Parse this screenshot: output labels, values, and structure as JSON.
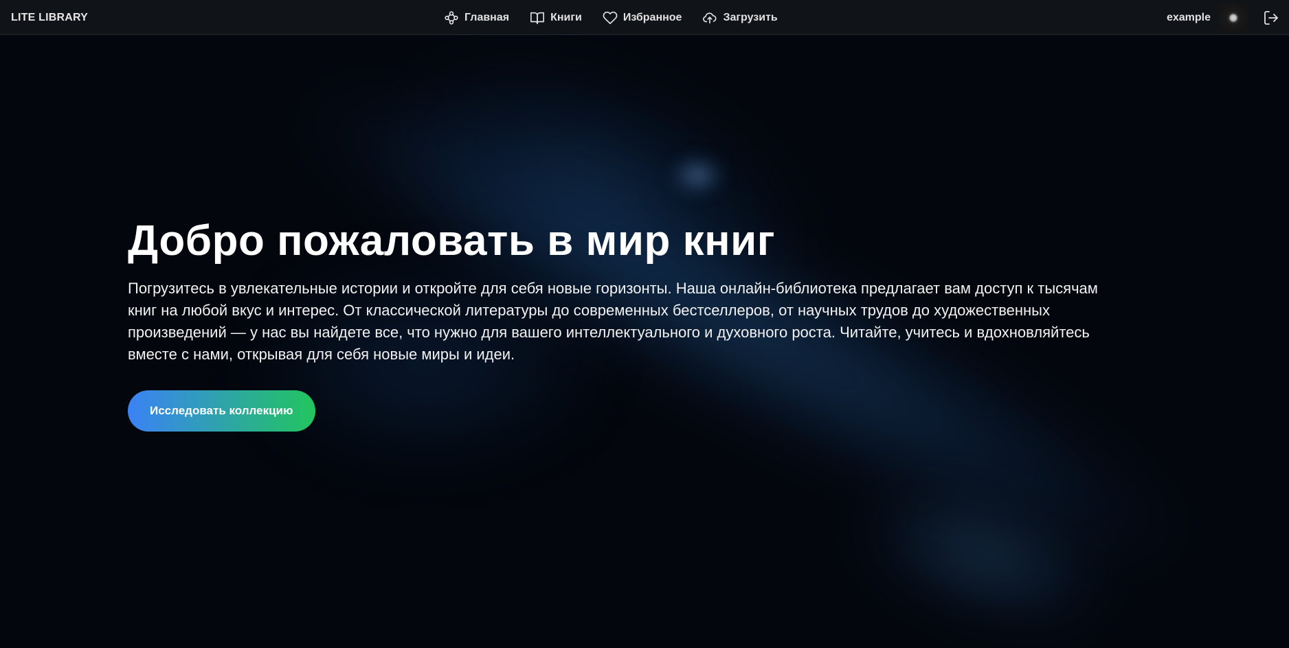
{
  "header": {
    "logo": "LITE LIBRARY",
    "nav": [
      {
        "label": "Главная",
        "icon": "nodes-icon"
      },
      {
        "label": "Книги",
        "icon": "open-book-icon"
      },
      {
        "label": "Избранное",
        "icon": "heart-icon"
      },
      {
        "label": "Загрузить",
        "icon": "cloud-upload-icon"
      }
    ],
    "username": "example",
    "logout_icon": "logout-icon"
  },
  "hero": {
    "title": "Добро пожаловать в мир книг",
    "text": "Погрузитесь в увлекательные истории и откройте для себя новые горизонты. Наша онлайн-библиотека предлагает вам доступ к тысячам книг на любой вкус и интерес. От классической литературы до современных бестселлеров, от научных трудов до художественных произведений — у нас вы найдете все, что нужно для вашего интеллектуального и духовного роста. Читайте, учитесь и вдохновляйтесь вместе с нами, открывая для себя новые миры и идеи.",
    "cta_label": "Исследовать коллекцию"
  },
  "colors": {
    "background": "#03060d",
    "header": "#101318",
    "cta_gradient_start": "#3b82f6",
    "cta_gradient_end": "#22c55e"
  }
}
